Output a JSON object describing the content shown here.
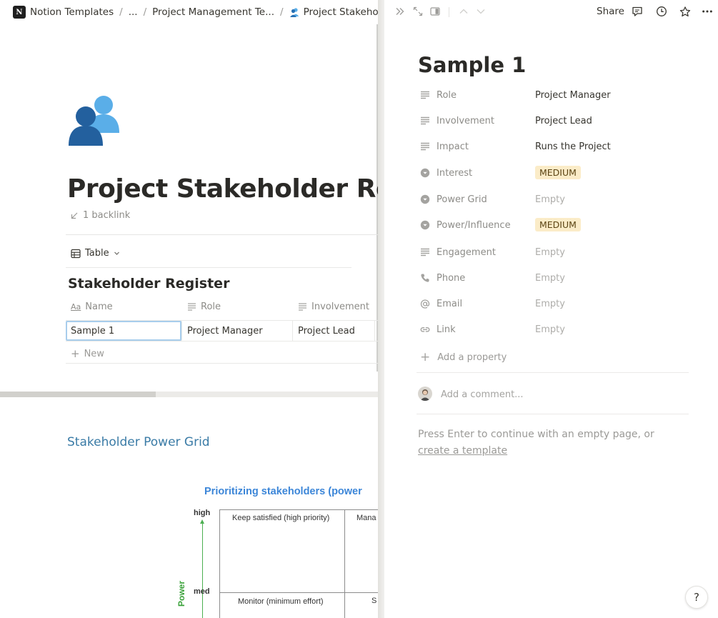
{
  "breadcrumb": {
    "workspace": "Notion Templates",
    "ellipsis": "...",
    "parent": "Project Management Te...",
    "current": "Project Stakeholder Regis"
  },
  "page": {
    "title": "Project Stakeholder Regi",
    "backlink": "1 backlink",
    "view_label": "Table",
    "database_title": "Stakeholder Register",
    "columns": [
      "Name",
      "Role",
      "Involvement"
    ],
    "row": {
      "name": "Sample 1",
      "role": "Project Manager",
      "involvement": "Project Lead"
    },
    "new_row_label": "New",
    "section_title": "Stakeholder Power Grid",
    "grid": {
      "title": "Prioritizing stakeholders  (power",
      "cells": [
        "Keep satisfied (high priority)",
        "Mana",
        "Monitor (minimum effort)",
        "S"
      ],
      "axis_high": "high",
      "axis_med": "med",
      "axis_label": "Power"
    }
  },
  "peek": {
    "share_label": "Share",
    "title": "Sample 1",
    "properties": [
      {
        "icon": "text-lines-icon",
        "name": "Role",
        "value": "Project Manager",
        "kind": "text"
      },
      {
        "icon": "text-lines-icon",
        "name": "Involvement",
        "value": "Project Lead",
        "kind": "text"
      },
      {
        "icon": "text-lines-icon",
        "name": "Impact",
        "value": "Runs the Project",
        "kind": "text"
      },
      {
        "icon": "select-icon",
        "name": "Interest",
        "value": "MEDIUM",
        "kind": "tag"
      },
      {
        "icon": "select-icon",
        "name": "Power Grid",
        "value": "Empty",
        "kind": "empty"
      },
      {
        "icon": "select-icon",
        "name": "Power/Influence",
        "value": "MEDIUM",
        "kind": "tag"
      },
      {
        "icon": "text-lines-icon",
        "name": "Engagement",
        "value": "Empty",
        "kind": "empty"
      },
      {
        "icon": "phone-icon",
        "name": "Phone",
        "value": "Empty",
        "kind": "empty"
      },
      {
        "icon": "at-icon",
        "name": "Email",
        "value": "Empty",
        "kind": "empty"
      },
      {
        "icon": "link-icon",
        "name": "Link",
        "value": "Empty",
        "kind": "empty"
      }
    ],
    "add_property": "Add a property",
    "comment_placeholder": "Add a comment...",
    "hint": "Press Enter to continue with an empty page, or",
    "hint_link": "create a template",
    "help": "?"
  },
  "colors": {
    "tag_bg": "#fbecc8",
    "tag_text": "#5c4514",
    "grid_title": "#3c86d8",
    "section_title": "#3a7ba6",
    "axis_green": "#4caf50"
  }
}
